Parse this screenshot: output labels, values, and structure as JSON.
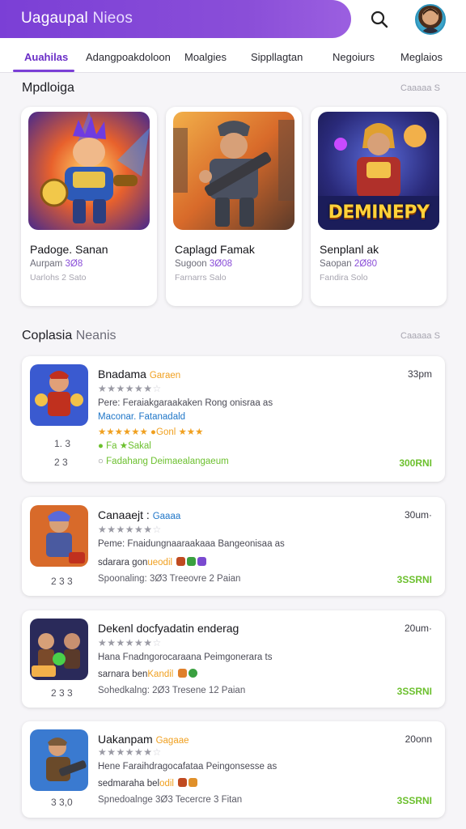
{
  "header": {
    "title_a": "Uagaupal",
    "title_b": "Nieos",
    "search_icon": "search-icon",
    "avatar_icon": "avatar"
  },
  "tabs": [
    {
      "label": "Auahilas",
      "active": true
    },
    {
      "label": "Adangpoakdoloon"
    },
    {
      "label": "Moalgies"
    },
    {
      "label": "Sippllagtan"
    },
    {
      "label": "Negoiurs"
    },
    {
      "label": "Meglaios"
    }
  ],
  "featured": {
    "title": "Mpdloiga",
    "more": "Caaaaa S",
    "cards": [
      {
        "name": "Padoge. Sanan",
        "line2_a": "Aurpam",
        "line2_b": "3Ø8",
        "line3": "Uarlohs 2 Sato",
        "art_text": ""
      },
      {
        "name": "Caplagd Famak",
        "line2_a": "Sugoon",
        "line2_b": "3Ø08",
        "line3": "Farnarrs Salo",
        "art_text": ""
      },
      {
        "name": "Senplanl ak",
        "line2_a": "Saopan",
        "line2_b": "2Ø80",
        "line3": "Fandira Solo",
        "art_text": "DEMINEPY"
      }
    ]
  },
  "list": {
    "title_a": "Coplasia",
    "title_b": "Neanis",
    "more": "Caaaaa S",
    "items": [
      {
        "title": "Bnadama",
        "tag": "Garaen",
        "time": "33pm",
        "desc": "Pere: Feraiakgaraakaken Rong onisraa as",
        "link": "Maconar. Fatanadald",
        "orange": "★★★★★★ ●Gonl ★★★",
        "green_line": "● Fa ★Sakal",
        "meta": "Fadahang Deimaealangaeum",
        "rank_a": "1. 3",
        "rank_b": "2 3",
        "price": "300RNI"
      },
      {
        "title": "Canaaejt :",
        "tag": "Gaaaa",
        "time": "30um·",
        "desc": "Peme: Fnaidungnaaraakaaa Bangeonisaa as",
        "orange": "sdarara gon",
        "orange_tail": "ueodil",
        "meta": "Spoonaling: 3Ø3 Treeovre 2 Paian",
        "rank_a": "2 3 3",
        "price": "3SSRNI"
      },
      {
        "title": "Dekenl docfyadatin enderag",
        "tag": "",
        "time": "20um·",
        "desc": "Hana Fnadngorocaraana Peimgonerara ts",
        "orange": "sarnara ben",
        "orange_tail": "Kandil",
        "meta": "Sohedkalng: 2Ø3 Tresene 12 Paian",
        "rank_a": "2 3 3",
        "price": "3SSRNI"
      },
      {
        "title": "Uakanpam",
        "tag": "Gagaae",
        "time": "20onn",
        "desc": "Hene Faraihdragocafataa Peingonsesse as",
        "orange": "sedmaraha bel",
        "orange_tail": "odil",
        "meta": "Spnedoalnge 3Ø3 Tecercre 3 Fitan",
        "rank_a": "3 3,0",
        "price": "3SSRNI"
      }
    ]
  },
  "colors": {
    "brand": "#7b3fd6",
    "price_green": "#6cc02e",
    "orange": "#f0a020"
  }
}
